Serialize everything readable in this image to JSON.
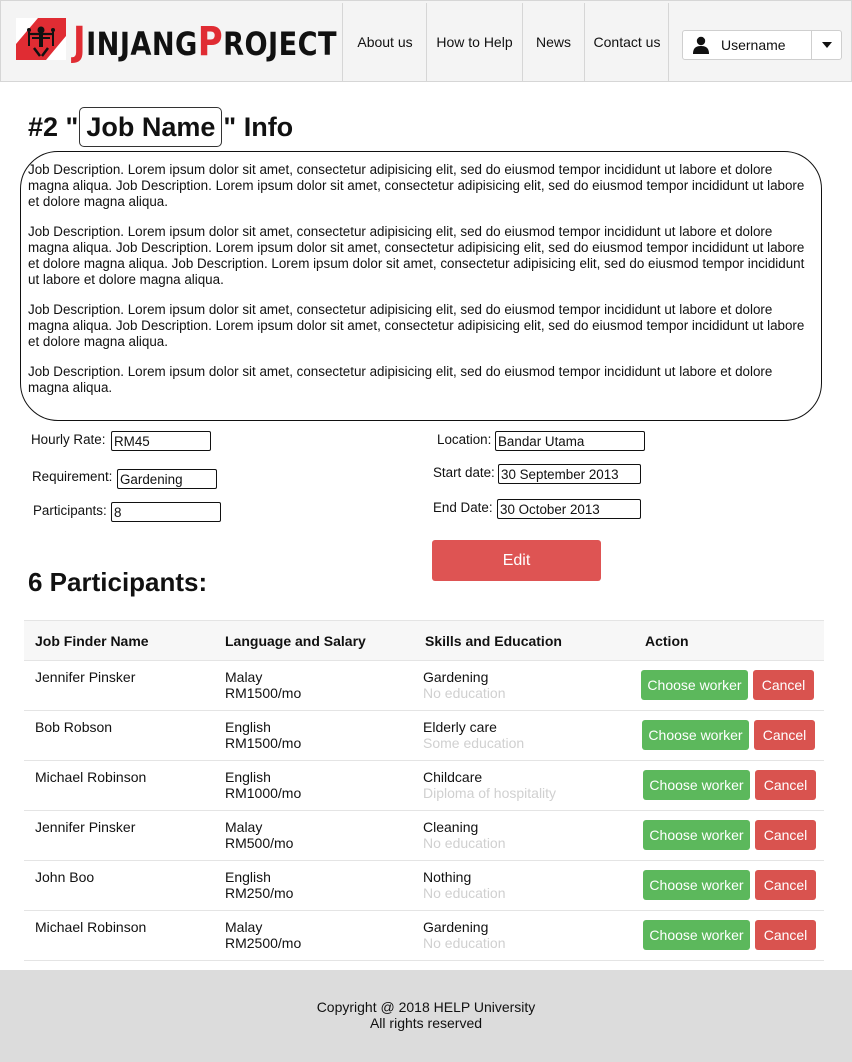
{
  "brand": {
    "first_initial": "J",
    "first_rest": "INJANG",
    "second_initial": "P",
    "second_rest": "ROJECT"
  },
  "nav": {
    "items": [
      "About us",
      "How to Help",
      "News",
      "Contact us"
    ],
    "username": "Username"
  },
  "title": {
    "prefix": "#2 \"",
    "job_name": "Job Name",
    "suffix": "\" Info"
  },
  "description": {
    "paragraphs": [
      "Job Description. Lorem ipsum dolor sit amet, consectetur adipisicing elit, sed do eiusmod tempor incididunt ut labore et dolore magna aliqua. Job Description. Lorem ipsum dolor sit amet, consectetur adipisicing elit, sed do eiusmod tempor incididunt ut labore et dolore magna aliqua.",
      " Job Description. Lorem ipsum dolor sit amet, consectetur adipisicing elit, sed do eiusmod tempor incididunt ut labore et dolore magna aliqua. Job Description. Lorem ipsum dolor sit amet, consectetur adipisicing elit, sed do eiusmod tempor incididunt ut labore et dolore magna aliqua. Job Description. Lorem ipsum dolor sit amet, consectetur adipisicing elit, sed do eiusmod tempor incididunt ut labore et dolore magna aliqua.",
      "Job Description. Lorem ipsum dolor sit amet, consectetur adipisicing elit, sed do eiusmod tempor incididunt ut labore et dolore magna aliqua. Job Description. Lorem ipsum dolor sit amet, consectetur adipisicing elit, sed do eiusmod tempor incididunt ut labore et dolore magna aliqua.",
      "Job Description. Lorem ipsum dolor sit amet, consectetur adipisicing elit, sed do eiusmod tempor incididunt ut labore et dolore magna aliqua."
    ]
  },
  "form": {
    "hourly_rate_label": "Hourly Rate:",
    "hourly_rate": "RM45",
    "requirement_label": "Requirement:",
    "requirement": "Gardening",
    "participants_label": "Participants:",
    "participants": "8",
    "location_label": "Location:",
    "location": "Bandar Utama",
    "start_date_label": "Start date:",
    "start_date": "30 September 2013",
    "end_date_label": "End Date:",
    "end_date": "30 October 2013",
    "edit_label": "Edit"
  },
  "participants": {
    "heading": "6 Participants:",
    "columns": [
      "Job Finder Name",
      "Language and Salary",
      "Skills and Education",
      "Action"
    ],
    "choose_label": "Choose worker",
    "cancel_label": "Cancel",
    "rows": [
      {
        "name": "Jennifer Pinsker",
        "language": "Malay",
        "salary": "RM1500/mo",
        "skill": "Gardening",
        "education": "No education"
      },
      {
        "name": "Bob Robson",
        "language": "English",
        "salary": "RM1500/mo",
        "skill": "Elderly care",
        "education": "Some education"
      },
      {
        "name": "Michael Robinson",
        "language": "English",
        "salary": "RM1000/mo",
        "skill": "Childcare",
        "education": "Diploma of hospitality"
      },
      {
        "name": "Jennifer Pinsker",
        "language": "Malay",
        "salary": "RM500/mo",
        "skill": "Cleaning",
        "education": "No education"
      },
      {
        "name": "John Boo",
        "language": "English",
        "salary": "RM250/mo",
        "skill": "Nothing",
        "education": "No education"
      },
      {
        "name": "Michael Robinson",
        "language": "Malay",
        "salary": "RM2500/mo",
        "skill": "Gardening",
        "education": "No education"
      }
    ]
  },
  "footer": {
    "copyright": "Copyright @ 2018 HELP University",
    "rights": "All rights reserved"
  },
  "colors": {
    "brand_red": "#e02c33",
    "edit_button": "#de5453",
    "choose_button": "#5cb85c",
    "cancel_button": "#d9534f",
    "footer_bg": "#dcdcdc",
    "header_bg": "#f4f4f4"
  },
  "icons": {
    "logo": "jinjang-logo-icon",
    "user": "user-icon",
    "dropdown": "chevron-down-icon"
  }
}
